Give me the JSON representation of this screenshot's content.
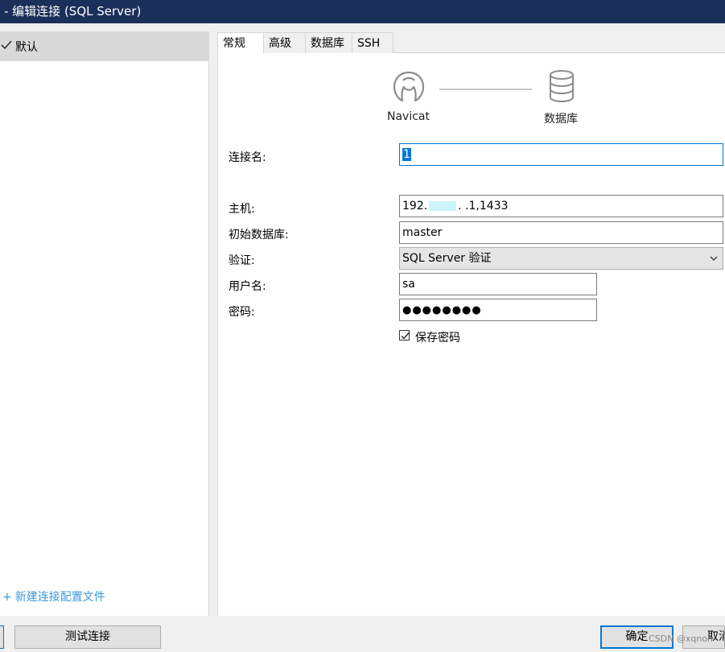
{
  "window": {
    "title": "- 编辑连接 (SQL Server)"
  },
  "sidebar": {
    "profile_label": "默认",
    "new_profile_label": "新建连接配置文件",
    "new_profile_plus": "+"
  },
  "tabs": [
    {
      "label": "常规",
      "active": true
    },
    {
      "label": "高级",
      "active": false
    },
    {
      "label": "数据库",
      "active": false
    },
    {
      "label": "SSH",
      "active": false
    }
  ],
  "diagram": {
    "left_label": "Navicat",
    "right_label": "数据库"
  },
  "form": {
    "connection_name": {
      "label": "连接名:",
      "value": "1"
    },
    "host": {
      "label": "主机:",
      "value_prefix": "192.",
      "value_suffix": ". .1,1433"
    },
    "initial_db": {
      "label": "初始数据库:",
      "value": "master"
    },
    "auth": {
      "label": "验证:",
      "value": "SQL Server 验证"
    },
    "username": {
      "label": "用户名:",
      "value": "sa"
    },
    "password": {
      "label": "密码:",
      "value": "●●●●●●●●"
    },
    "save_password": {
      "label": "保存密码",
      "checked": true
    }
  },
  "buttons": {
    "test": "测试连接",
    "ok": "确定",
    "cancel": "取消"
  },
  "watermark": "CSDN @xqnon",
  "colors": {
    "titlebar": "#1b2f5b",
    "accent": "#0078d7",
    "link": "#3b9ad8"
  }
}
